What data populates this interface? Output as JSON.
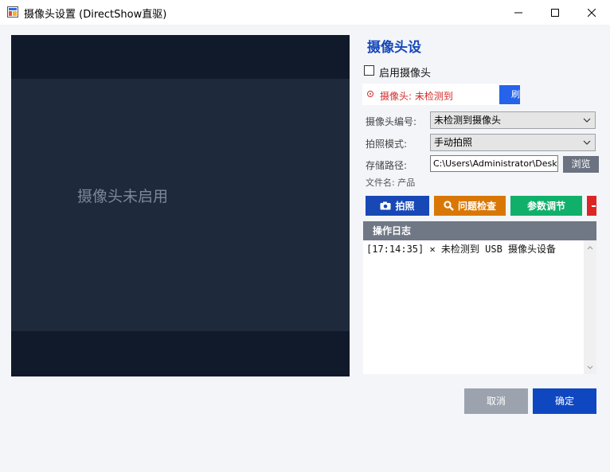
{
  "window": {
    "title": "摄像头设置 (DirectShow直驱)",
    "icon": "app-window-icon"
  },
  "preview": {
    "placeholder": "摄像头未启用"
  },
  "panel": {
    "title": "摄像头设",
    "enable_label": "启用摄像头",
    "enable_checked": false,
    "status_text": "摄像头: 未检测到",
    "refresh_label": "刷",
    "camera_id_label": "摄像头编号:",
    "camera_id_value": "未检测到摄像头",
    "capture_mode_label": "拍照模式:",
    "capture_mode_value": "手动拍照",
    "storage_path_label": "存储路径:",
    "storage_path_value": "C:\\Users\\Administrator\\Deskt",
    "browse_label": "浏览",
    "filename_text": "文件名: 产品"
  },
  "actions": [
    {
      "label": "拍照",
      "icon": "camera-icon",
      "color": "#1848b6"
    },
    {
      "label": "问题检查",
      "icon": "search-icon",
      "color": "#d97706"
    },
    {
      "label": "参数调节",
      "icon": "",
      "color": "#10b06a"
    }
  ],
  "log": {
    "header": "操作日志",
    "lines": [
      "[17:14:35] ✕ 未检测到 USB 摄像头设备"
    ]
  },
  "footer": {
    "cancel_label": "取消",
    "ok_label": "确定"
  },
  "colors": {
    "accent": "#0f47c1",
    "error": "#d12b2b",
    "preview_bg": "#111a2b"
  }
}
